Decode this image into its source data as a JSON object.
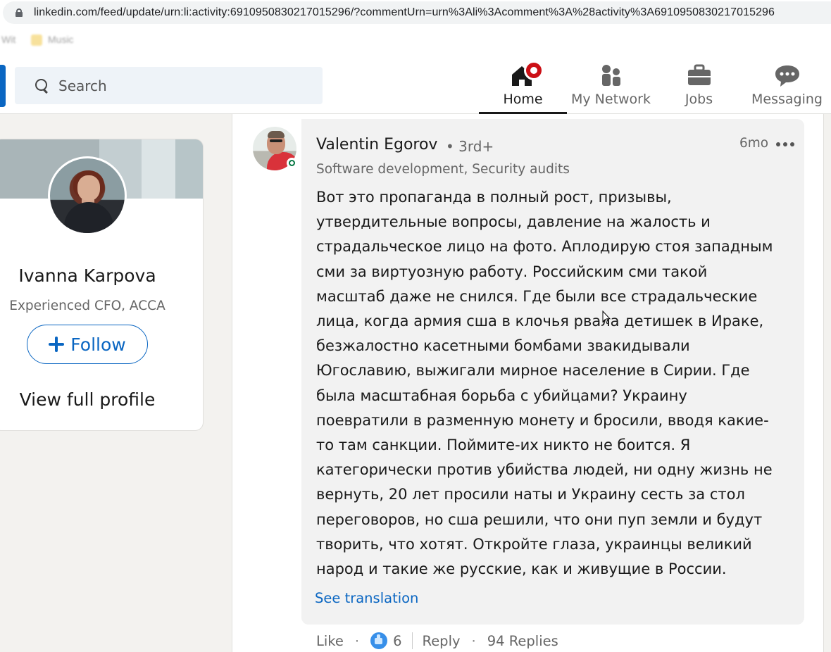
{
  "browser": {
    "url": "linkedin.com/feed/update/urn:li:activity:6910950830217015296/?commentUrn=urn%3Ali%3Acomment%3A%28activity%3A6910950830217015296"
  },
  "bookmarks": [
    {
      "label": "Wit"
    },
    {
      "label": "Music"
    }
  ],
  "nav": {
    "search_placeholder": "Search",
    "items": [
      {
        "label": "Home",
        "icon": "home-icon",
        "active": true
      },
      {
        "label": "My Network",
        "icon": "network-icon"
      },
      {
        "label": "Jobs",
        "icon": "briefcase-icon"
      },
      {
        "label": "Messaging",
        "icon": "messaging-icon"
      }
    ]
  },
  "profile": {
    "name": "Ivanna Karpova",
    "headline": "Experienced CFO, ACCA",
    "follow_label": "Follow",
    "view_profile_label": "View full profile"
  },
  "comment": {
    "author": "Valentin Egorov",
    "degree": "• 3rd+",
    "headline": "Software development, Security audits",
    "time": "6mo",
    "text_lines": [
      "Вот это пропаганда в полный рост, призывы,",
      "утвердительные вопросы, давление на жалость и",
      "страдальческое лицо на фото. Аплодирую стоя западным",
      "сми за виртуозную работу. Российским сми такой",
      "масштаб даже не снился. Где были все страдальческие",
      "лица, когда армия сша в клочья рвала детишек в Ираке,",
      "безжалостно касетными бомбами звакидывали",
      "Югославию, выжигали мирное население в Сирии. Где",
      "была масштабная борьба с убийцами? Украину",
      "поевратили в разменную монету и бросили, вводя какие-",
      "то там санкции. Поймите-их никто не боится. Я",
      "категорически против убийства людей, ни одну жизнь не",
      "вернуть, 20 лет просили наты и Украину сесть за стол",
      "переговоров, но сша решили, что они пуп земли и будут",
      "творить, что хотят. Откройте глаза, украинцы великий",
      "народ и такие же русские, как и живущие в России."
    ],
    "see_translation": "See translation",
    "like_label": "Like",
    "reaction_count": "6",
    "reply_label": "Reply",
    "replies": "94 Replies"
  },
  "colors": {
    "brand_blue": "#0a66c2",
    "notification_red": "#cc1016",
    "background": "#f3f2ef",
    "comment_bubble": "#f2f2f2"
  }
}
